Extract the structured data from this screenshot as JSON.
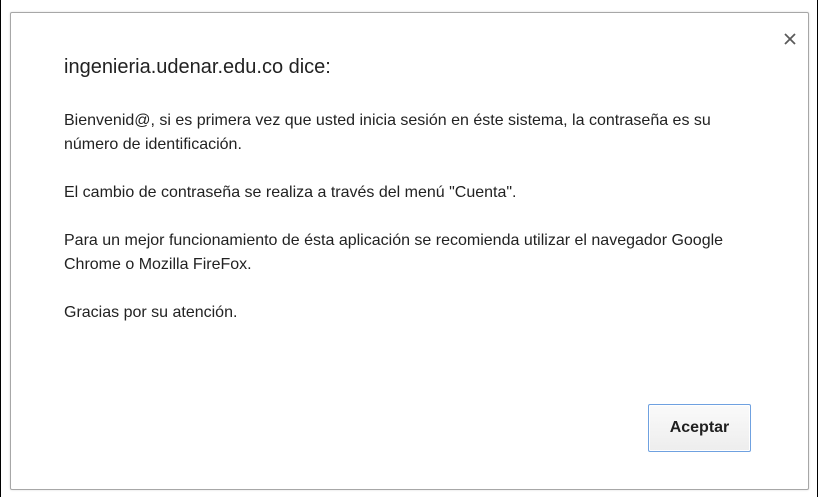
{
  "dialog": {
    "title": "ingenieria.udenar.edu.co dice:",
    "paragraphs": {
      "p1": "Bienvenid@, si es primera vez que usted inicia sesión en éste sistema, la contraseña es su número de identificación.",
      "p2": "El cambio de contraseña se realiza a través del menú \"Cuenta\".",
      "p3": "Para un mejor funcionamiento de ésta aplicación se recomienda utilizar el navegador Google Chrome o Mozilla FireFox.",
      "p4": "Gracias por su atención."
    },
    "accept_label": "Aceptar",
    "close_icon": "close-icon"
  },
  "colors": {
    "button_border": "#6fa1e0",
    "dialog_border": "#a7a7a7",
    "text": "#222222"
  }
}
